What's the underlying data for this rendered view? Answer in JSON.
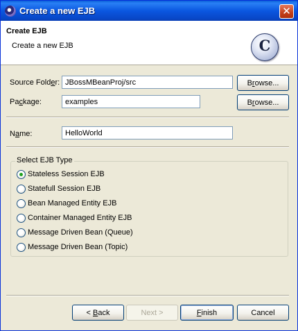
{
  "window": {
    "title": "Create a new EJB",
    "close_glyph": "✕"
  },
  "banner": {
    "title": "Create EJB",
    "description": "Create a new EJB",
    "logo_letter": "C"
  },
  "form": {
    "source_folder": {
      "label": "Source Folder:",
      "value": "JBossMBeanProj/src",
      "browse_label": "Browse..."
    },
    "package": {
      "label": "Package:",
      "value": "examples",
      "browse_label": "Browse..."
    },
    "name": {
      "label": "Name:",
      "value": "HelloWorld"
    }
  },
  "ejb_type": {
    "legend": "Select EJB Type",
    "selected_index": 0,
    "options": [
      "Stateless Session EJB",
      "Statefull Session EJB",
      "Bean Managed Entity EJB",
      "Container Managed Entity EJB",
      "Message Driven Bean (Queue)",
      "Message Driven Bean (Topic)"
    ]
  },
  "buttons": {
    "back": "< Back",
    "next": "Next >",
    "finish": "Finish",
    "cancel": "Cancel"
  },
  "colors": {
    "title_bar": "#0b57e0",
    "dialog_face": "#ece9d8",
    "radio_dot": "#21a121",
    "close_button": "#c4401c"
  }
}
